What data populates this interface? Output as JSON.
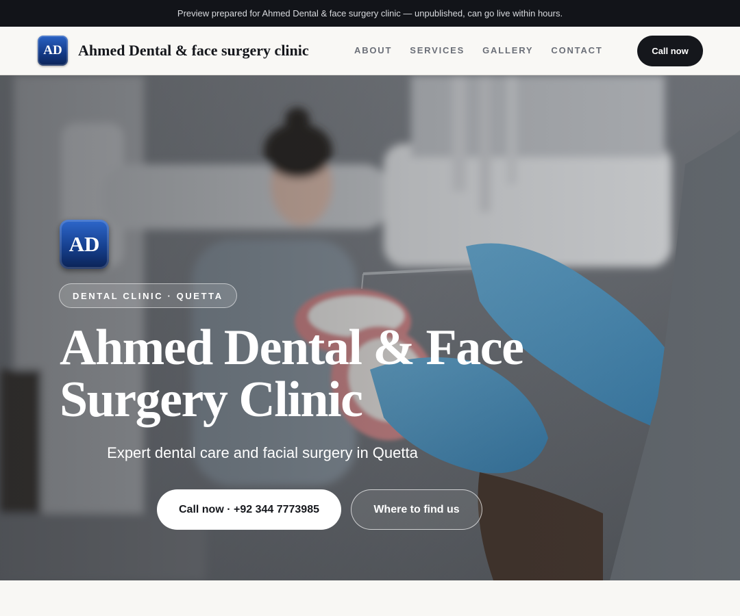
{
  "preview_banner": "Preview prepared for Ahmed Dental & face surgery clinic — unpublished, can go live within hours.",
  "header": {
    "logo_text": "AD",
    "brand": "Ahmed Dental & face surgery clinic",
    "nav": [
      "ABOUT",
      "SERVICES",
      "GALLERY",
      "CONTACT"
    ],
    "call_button": "Call now"
  },
  "hero": {
    "logo_text": "AD",
    "category_pill": "DENTAL CLINIC · QUETTA",
    "title_line1": "Ahmed Dental & Face",
    "title_line2": "Surgery Clinic",
    "tagline": "Expert dental care and facial surgery in Quetta",
    "primary_cta": "Call now · +92 344 7773985",
    "secondary_cta": "Where to find us",
    "background_image": "dentist-holding-denture-model-photo"
  },
  "colors": {
    "topbar": "#121419",
    "header_bg": "#f9f8f5",
    "accent_dark": "#15171c",
    "logo_blue": "#143c8a",
    "glove_blue": "#4c9ccb"
  }
}
